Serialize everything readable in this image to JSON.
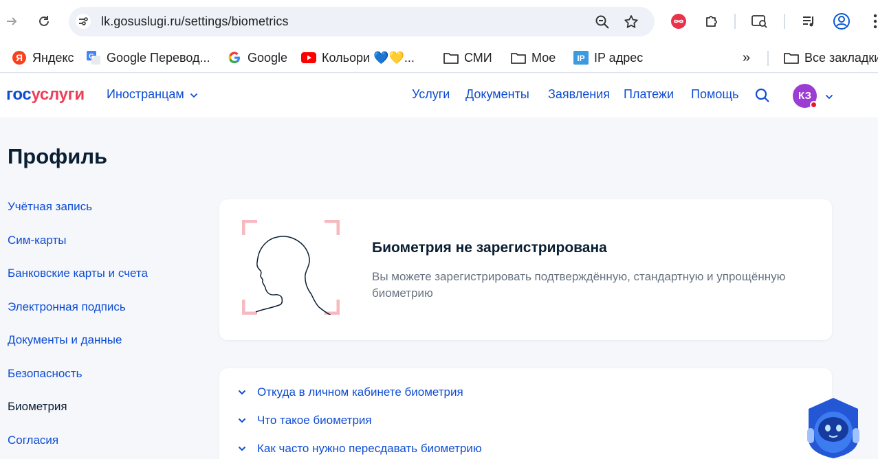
{
  "browser": {
    "url": "lk.gosuslugi.ru/settings/biometrics",
    "bookmarks": [
      {
        "label": "Яндекс",
        "icon": "yandex-icon"
      },
      {
        "label": "Google Перевод...",
        "icon": "google-translate-icon"
      },
      {
        "label": "Google",
        "icon": "google-icon"
      },
      {
        "label": "Кольори 💙💛...",
        "icon": "youtube-icon"
      },
      {
        "label": "СМИ",
        "icon": "folder-icon"
      },
      {
        "label": "Мое",
        "icon": "folder-icon"
      },
      {
        "label": "IP адрес",
        "icon": "ip-icon"
      }
    ],
    "more_bookmarks": "»",
    "all_bookmarks": "Все закладки"
  },
  "header": {
    "logo_part1": "гос",
    "logo_part2": "услуги",
    "lang_menu": "Иностранцам",
    "nav": [
      "Услуги",
      "Документы",
      "Заявления",
      "Платежи",
      "Помощь"
    ],
    "avatar_initials": "КЗ"
  },
  "page": {
    "title": "Профиль",
    "sidebar": [
      {
        "label": "Учётная запись",
        "active": false
      },
      {
        "label": "Сим-карты",
        "active": false
      },
      {
        "label": "Банковские карты и счета",
        "active": false
      },
      {
        "label": "Электронная подпись",
        "active": false
      },
      {
        "label": "Документы и данные",
        "active": false
      },
      {
        "label": "Безопасность",
        "active": false
      },
      {
        "label": "Биометрия",
        "active": true
      },
      {
        "label": "Согласия",
        "active": false
      }
    ]
  },
  "biometry": {
    "title": "Биометрия не зарегистрирована",
    "description": "Вы можете зарегистрировать подтверждённую, стандартную и упрощённую биометрию"
  },
  "faq": [
    "Откуда в личном кабинете биометрия",
    "Что такое биометрия",
    "Как часто нужно пересдавать биометрию"
  ],
  "colors": {
    "brand_blue": "#0d4cd3",
    "brand_red": "#ee3f58",
    "avatar": "#9c3cd3",
    "text_dark": "#0b1f33",
    "text_muted": "#66727f",
    "background": "#f5f7fb"
  }
}
